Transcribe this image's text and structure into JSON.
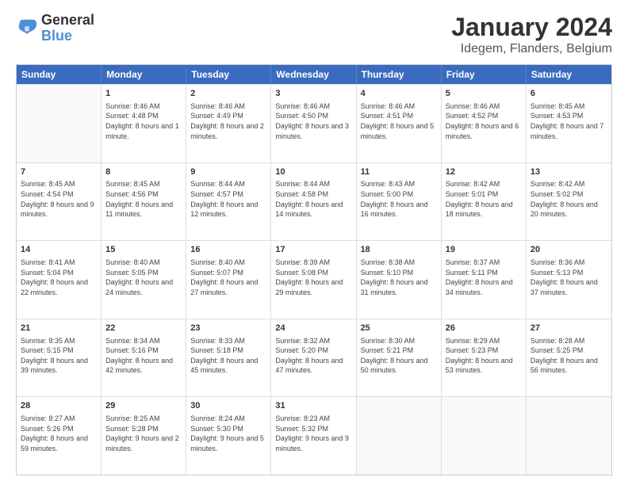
{
  "logo": {
    "line1": "General",
    "line2": "Blue"
  },
  "header": {
    "title": "January 2024",
    "subtitle": "Idegem, Flanders, Belgium"
  },
  "weekdays": [
    "Sunday",
    "Monday",
    "Tuesday",
    "Wednesday",
    "Thursday",
    "Friday",
    "Saturday"
  ],
  "weeks": [
    [
      {
        "day": "",
        "empty": true
      },
      {
        "day": "1",
        "sunrise": "Sunrise: 8:46 AM",
        "sunset": "Sunset: 4:48 PM",
        "daylight": "Daylight: 8 hours and 1 minute."
      },
      {
        "day": "2",
        "sunrise": "Sunrise: 8:46 AM",
        "sunset": "Sunset: 4:49 PM",
        "daylight": "Daylight: 8 hours and 2 minutes."
      },
      {
        "day": "3",
        "sunrise": "Sunrise: 8:46 AM",
        "sunset": "Sunset: 4:50 PM",
        "daylight": "Daylight: 8 hours and 3 minutes."
      },
      {
        "day": "4",
        "sunrise": "Sunrise: 8:46 AM",
        "sunset": "Sunset: 4:51 PM",
        "daylight": "Daylight: 8 hours and 5 minutes."
      },
      {
        "day": "5",
        "sunrise": "Sunrise: 8:46 AM",
        "sunset": "Sunset: 4:52 PM",
        "daylight": "Daylight: 8 hours and 6 minutes."
      },
      {
        "day": "6",
        "sunrise": "Sunrise: 8:45 AM",
        "sunset": "Sunset: 4:53 PM",
        "daylight": "Daylight: 8 hours and 7 minutes."
      }
    ],
    [
      {
        "day": "7",
        "sunrise": "Sunrise: 8:45 AM",
        "sunset": "Sunset: 4:54 PM",
        "daylight": "Daylight: 8 hours and 9 minutes."
      },
      {
        "day": "8",
        "sunrise": "Sunrise: 8:45 AM",
        "sunset": "Sunset: 4:56 PM",
        "daylight": "Daylight: 8 hours and 11 minutes."
      },
      {
        "day": "9",
        "sunrise": "Sunrise: 8:44 AM",
        "sunset": "Sunset: 4:57 PM",
        "daylight": "Daylight: 8 hours and 12 minutes."
      },
      {
        "day": "10",
        "sunrise": "Sunrise: 8:44 AM",
        "sunset": "Sunset: 4:58 PM",
        "daylight": "Daylight: 8 hours and 14 minutes."
      },
      {
        "day": "11",
        "sunrise": "Sunrise: 8:43 AM",
        "sunset": "Sunset: 5:00 PM",
        "daylight": "Daylight: 8 hours and 16 minutes."
      },
      {
        "day": "12",
        "sunrise": "Sunrise: 8:42 AM",
        "sunset": "Sunset: 5:01 PM",
        "daylight": "Daylight: 8 hours and 18 minutes."
      },
      {
        "day": "13",
        "sunrise": "Sunrise: 8:42 AM",
        "sunset": "Sunset: 5:02 PM",
        "daylight": "Daylight: 8 hours and 20 minutes."
      }
    ],
    [
      {
        "day": "14",
        "sunrise": "Sunrise: 8:41 AM",
        "sunset": "Sunset: 5:04 PM",
        "daylight": "Daylight: 8 hours and 22 minutes."
      },
      {
        "day": "15",
        "sunrise": "Sunrise: 8:40 AM",
        "sunset": "Sunset: 5:05 PM",
        "daylight": "Daylight: 8 hours and 24 minutes."
      },
      {
        "day": "16",
        "sunrise": "Sunrise: 8:40 AM",
        "sunset": "Sunset: 5:07 PM",
        "daylight": "Daylight: 8 hours and 27 minutes."
      },
      {
        "day": "17",
        "sunrise": "Sunrise: 8:39 AM",
        "sunset": "Sunset: 5:08 PM",
        "daylight": "Daylight: 8 hours and 29 minutes."
      },
      {
        "day": "18",
        "sunrise": "Sunrise: 8:38 AM",
        "sunset": "Sunset: 5:10 PM",
        "daylight": "Daylight: 8 hours and 31 minutes."
      },
      {
        "day": "19",
        "sunrise": "Sunrise: 8:37 AM",
        "sunset": "Sunset: 5:11 PM",
        "daylight": "Daylight: 8 hours and 34 minutes."
      },
      {
        "day": "20",
        "sunrise": "Sunrise: 8:36 AM",
        "sunset": "Sunset: 5:13 PM",
        "daylight": "Daylight: 8 hours and 37 minutes."
      }
    ],
    [
      {
        "day": "21",
        "sunrise": "Sunrise: 8:35 AM",
        "sunset": "Sunset: 5:15 PM",
        "daylight": "Daylight: 8 hours and 39 minutes."
      },
      {
        "day": "22",
        "sunrise": "Sunrise: 8:34 AM",
        "sunset": "Sunset: 5:16 PM",
        "daylight": "Daylight: 8 hours and 42 minutes."
      },
      {
        "day": "23",
        "sunrise": "Sunrise: 8:33 AM",
        "sunset": "Sunset: 5:18 PM",
        "daylight": "Daylight: 8 hours and 45 minutes."
      },
      {
        "day": "24",
        "sunrise": "Sunrise: 8:32 AM",
        "sunset": "Sunset: 5:20 PM",
        "daylight": "Daylight: 8 hours and 47 minutes."
      },
      {
        "day": "25",
        "sunrise": "Sunrise: 8:30 AM",
        "sunset": "Sunset: 5:21 PM",
        "daylight": "Daylight: 8 hours and 50 minutes."
      },
      {
        "day": "26",
        "sunrise": "Sunrise: 8:29 AM",
        "sunset": "Sunset: 5:23 PM",
        "daylight": "Daylight: 8 hours and 53 minutes."
      },
      {
        "day": "27",
        "sunrise": "Sunrise: 8:28 AM",
        "sunset": "Sunset: 5:25 PM",
        "daylight": "Daylight: 8 hours and 56 minutes."
      }
    ],
    [
      {
        "day": "28",
        "sunrise": "Sunrise: 8:27 AM",
        "sunset": "Sunset: 5:26 PM",
        "daylight": "Daylight: 8 hours and 59 minutes."
      },
      {
        "day": "29",
        "sunrise": "Sunrise: 8:25 AM",
        "sunset": "Sunset: 5:28 PM",
        "daylight": "Daylight: 9 hours and 2 minutes."
      },
      {
        "day": "30",
        "sunrise": "Sunrise: 8:24 AM",
        "sunset": "Sunset: 5:30 PM",
        "daylight": "Daylight: 9 hours and 5 minutes."
      },
      {
        "day": "31",
        "sunrise": "Sunrise: 8:23 AM",
        "sunset": "Sunset: 5:32 PM",
        "daylight": "Daylight: 9 hours and 9 minutes."
      },
      {
        "day": "",
        "empty": true
      },
      {
        "day": "",
        "empty": true
      },
      {
        "day": "",
        "empty": true
      }
    ]
  ]
}
